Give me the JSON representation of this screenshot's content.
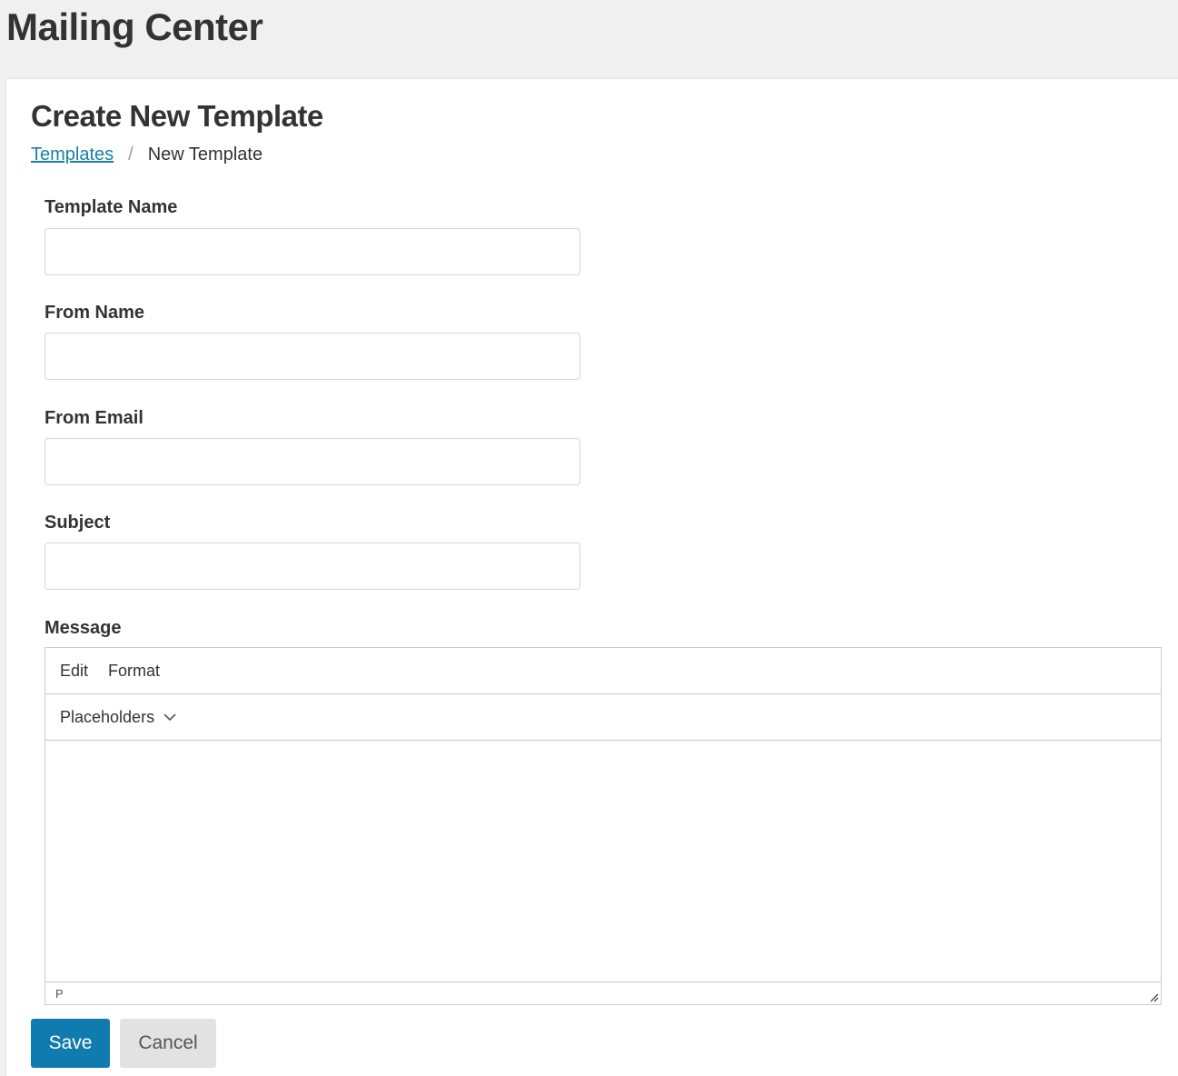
{
  "app": {
    "title": "Mailing Center"
  },
  "page": {
    "title": "Create New Template"
  },
  "breadcrumb": {
    "link_label": "Templates",
    "separator": "/",
    "current": "New Template"
  },
  "form": {
    "template_name": {
      "label": "Template Name",
      "value": ""
    },
    "from_name": {
      "label": "From Name",
      "value": ""
    },
    "from_email": {
      "label": "From Email",
      "value": ""
    },
    "subject": {
      "label": "Subject",
      "value": ""
    },
    "message": {
      "label": "Message"
    }
  },
  "editor": {
    "menu": [
      "Edit",
      "Format"
    ],
    "toolbar_dropdown": "Placeholders",
    "status_path": "P"
  },
  "buttons": {
    "save": "Save",
    "cancel": "Cancel"
  },
  "colors": {
    "primary": "#0f7bae",
    "link": "#1a7fa8",
    "header_bg": "#f0f0f0"
  }
}
